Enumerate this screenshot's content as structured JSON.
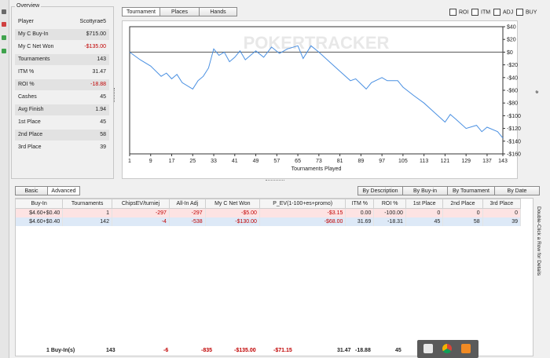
{
  "overview": {
    "title": "Overview",
    "rows": [
      {
        "label": "Player",
        "value": "Scottyrae5"
      },
      {
        "label": "My C Buy-In",
        "value": "$715.00"
      },
      {
        "label": "My C Net Won",
        "value": "-$135.00"
      },
      {
        "label": "Tournaments",
        "value": "143"
      },
      {
        "label": "ITM %",
        "value": "31.47"
      },
      {
        "label": "ROI %",
        "value": "-18.88"
      },
      {
        "label": "Cashes",
        "value": "45"
      },
      {
        "label": "Avg Finish",
        "value": "1.94"
      },
      {
        "label": "1st Place",
        "value": "45"
      },
      {
        "label": "2nd Place",
        "value": "58"
      },
      {
        "label": "3rd Place",
        "value": "39"
      }
    ]
  },
  "chart_tabs": [
    "Tournament",
    "Places",
    "Hands"
  ],
  "filters": [
    "ROI",
    "ITM",
    "ADJ",
    "BUY"
  ],
  "chart": {
    "watermark": "POKERTRACKER",
    "xlabel": "Tournaments Played",
    "ylabel": "$",
    "line_color": "#4a90e2",
    "xticks": [
      "1",
      "9",
      "17",
      "25",
      "33",
      "41",
      "49",
      "57",
      "65",
      "73",
      "81",
      "89",
      "97",
      "105",
      "113",
      "121",
      "129",
      "137",
      "143"
    ],
    "yticks": [
      "$40",
      "$20",
      "$0",
      "-$20",
      "-$40",
      "-$60",
      "-$80",
      "-$100",
      "-$120",
      "-$140",
      "-$160"
    ]
  },
  "chart_data": {
    "type": "line",
    "xlabel": "Tournaments Played",
    "ylabel": "$",
    "ylim": [
      -160,
      40
    ],
    "xlim": [
      1,
      143
    ],
    "series": [
      {
        "points": [
          [
            1,
            0
          ],
          [
            5,
            -12
          ],
          [
            9,
            -22
          ],
          [
            13,
            -38
          ],
          [
            15,
            -33
          ],
          [
            17,
            -42
          ],
          [
            19,
            -35
          ],
          [
            21,
            -48
          ],
          [
            25,
            -58
          ],
          [
            27,
            -45
          ],
          [
            29,
            -38
          ],
          [
            31,
            -25
          ],
          [
            33,
            5
          ],
          [
            35,
            -5
          ],
          [
            37,
            0
          ],
          [
            39,
            -15
          ],
          [
            41,
            -8
          ],
          [
            43,
            2
          ],
          [
            45,
            -12
          ],
          [
            49,
            2
          ],
          [
            52,
            -8
          ],
          [
            55,
            8
          ],
          [
            58,
            -2
          ],
          [
            61,
            5
          ],
          [
            65,
            10
          ],
          [
            67,
            -10
          ],
          [
            70,
            10
          ],
          [
            73,
            0
          ],
          [
            77,
            -15
          ],
          [
            81,
            -30
          ],
          [
            85,
            -45
          ],
          [
            87,
            -42
          ],
          [
            89,
            -50
          ],
          [
            91,
            -58
          ],
          [
            93,
            -48
          ],
          [
            97,
            -40
          ],
          [
            99,
            -45
          ],
          [
            103,
            -45
          ],
          [
            105,
            -55
          ],
          [
            109,
            -68
          ],
          [
            113,
            -80
          ],
          [
            117,
            -95
          ],
          [
            121,
            -110
          ],
          [
            123,
            -98
          ],
          [
            125,
            -105
          ],
          [
            129,
            -120
          ],
          [
            133,
            -115
          ],
          [
            135,
            -125
          ],
          [
            137,
            -118
          ],
          [
            141,
            -125
          ],
          [
            143,
            -135
          ]
        ]
      }
    ]
  },
  "tabs": {
    "basic": "Basic",
    "advanced": "Advanced"
  },
  "groupings": [
    "By Description",
    "By Buy-in",
    "By Tournament",
    "By Date"
  ],
  "table": {
    "headers": [
      "Buy-In",
      "Tournaments",
      "ChipsEV/turniej",
      "All-In Adj",
      "My C Net Won",
      "P_EV(1-100+es+promo)",
      "ITM %",
      "ROI %",
      "1st Place",
      "2nd Place",
      "3rd Place"
    ],
    "rows": [
      [
        "$4.60+$0.40",
        "1",
        "-297",
        "-297",
        "-$5.00",
        "-$3.15",
        "0.00",
        "-100.00",
        "0",
        "0",
        "0"
      ],
      [
        "$4.60+$0.40",
        "142",
        "-4",
        "-538",
        "-$130.00",
        "-$68.00",
        "31.69",
        "-18.31",
        "45",
        "58",
        "39"
      ]
    ],
    "footer": [
      "1 Buy-In(s)",
      "143",
      "-6",
      "-835",
      "-$135.00",
      "-$71.15",
      "31.47",
      "-18.88",
      "45"
    ]
  },
  "side_hint": "Double-Click a Row for Details"
}
